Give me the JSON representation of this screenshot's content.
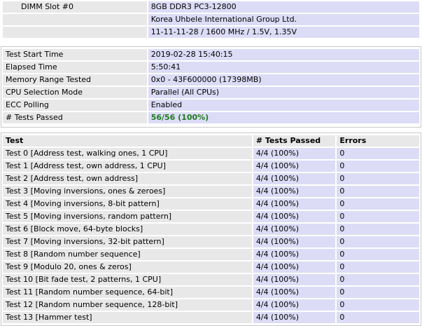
{
  "dimm": {
    "slot_label": "DIMM Slot #0",
    "lines": [
      "8GB DDR3 PC3-12800",
      "Korea Uhbele International Group Ltd.",
      "11-11-11-28 / 1600 MHz / 1.5V, 1.35V"
    ]
  },
  "summary": [
    {
      "label": "Test Start Time",
      "value": "2019-02-28 15:40:15"
    },
    {
      "label": "Elapsed Time",
      "value": "5:50:41"
    },
    {
      "label": "Memory Range Tested",
      "value": "0x0 - 43F600000 (17398MB)"
    },
    {
      "label": "CPU Selection Mode",
      "value": "Parallel (All CPUs)"
    },
    {
      "label": "ECC Polling",
      "value": "Enabled"
    },
    {
      "label": "# Tests Passed",
      "value": "56/56 (100%)"
    }
  ],
  "results": {
    "headers": {
      "test": "Test",
      "passed": "# Tests Passed",
      "errors": "Errors"
    },
    "rows": [
      {
        "test": "Test 0 [Address test, walking ones, 1 CPU]",
        "passed": "4/4 (100%)",
        "errors": "0"
      },
      {
        "test": "Test 1 [Address test, own address, 1 CPU]",
        "passed": "4/4 (100%)",
        "errors": "0"
      },
      {
        "test": "Test 2 [Address test, own address]",
        "passed": "4/4 (100%)",
        "errors": "0"
      },
      {
        "test": "Test 3 [Moving inversions, ones & zeroes]",
        "passed": "4/4 (100%)",
        "errors": "0"
      },
      {
        "test": "Test 4 [Moving inversions, 8-bit pattern]",
        "passed": "4/4 (100%)",
        "errors": "0"
      },
      {
        "test": "Test 5 [Moving inversions, random pattern]",
        "passed": "4/4 (100%)",
        "errors": "0"
      },
      {
        "test": "Test 6 [Block move, 64-byte blocks]",
        "passed": "4/4 (100%)",
        "errors": "0"
      },
      {
        "test": "Test 7 [Moving inversions, 32-bit pattern]",
        "passed": "4/4 (100%)",
        "errors": "0"
      },
      {
        "test": "Test 8 [Random number sequence]",
        "passed": "4/4 (100%)",
        "errors": "0"
      },
      {
        "test": "Test 9 [Modulo 20, ones & zeros]",
        "passed": "4/4 (100%)",
        "errors": "0"
      },
      {
        "test": "Test 10 [Bit fade test, 2 patterns, 1 CPU]",
        "passed": "4/4 (100%)",
        "errors": "0"
      },
      {
        "test": "Test 11 [Random number sequence, 64-bit]",
        "passed": "4/4 (100%)",
        "errors": "0"
      },
      {
        "test": "Test 12 [Random number sequence, 128-bit]",
        "passed": "4/4 (100%)",
        "errors": "0"
      },
      {
        "test": "Test 13 [Hammer test]",
        "passed": "4/4 (100%)",
        "errors": "0"
      }
    ]
  }
}
